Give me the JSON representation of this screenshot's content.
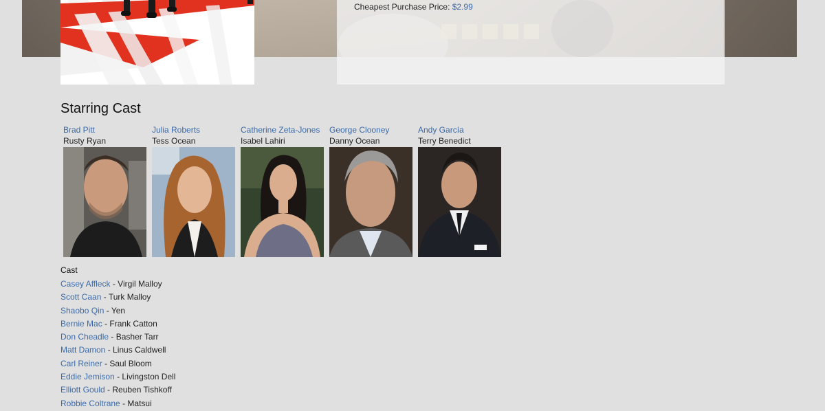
{
  "purchase": {
    "label": "Cheapest Purchase Price:",
    "price": "$2.99"
  },
  "starring": {
    "title": "Starring Cast",
    "members": [
      {
        "name": "Brad Pitt",
        "role": "Rusty Ryan"
      },
      {
        "name": "Julia Roberts",
        "role": "Tess Ocean"
      },
      {
        "name": "Catherine Zeta-Jones",
        "role": "Isabel Lahiri"
      },
      {
        "name": "George Clooney",
        "role": "Danny Ocean"
      },
      {
        "name": "Andy García",
        "role": "Terry Benedict"
      }
    ]
  },
  "cast": {
    "heading": "Cast",
    "separator": "-",
    "members": [
      {
        "name": "Casey Affleck",
        "role": "Virgil Malloy"
      },
      {
        "name": "Scott Caan",
        "role": "Turk Malloy"
      },
      {
        "name": "Shaobo Qin",
        "role": "Yen"
      },
      {
        "name": "Bernie Mac",
        "role": "Frank Catton"
      },
      {
        "name": "Don Cheadle",
        "role": "Basher Tarr"
      },
      {
        "name": "Matt Damon",
        "role": "Linus Caldwell"
      },
      {
        "name": "Carl Reiner",
        "role": "Saul Bloom"
      },
      {
        "name": "Eddie Jemison",
        "role": "Livingston Dell"
      },
      {
        "name": "Elliott Gould",
        "role": "Reuben Tishkoff"
      },
      {
        "name": "Robbie Coltrane",
        "role": "Matsui"
      }
    ]
  },
  "colors": {
    "page_background": "#e0e0e0",
    "link": "#3b6aa8",
    "poster_red": "#e0321e"
  }
}
